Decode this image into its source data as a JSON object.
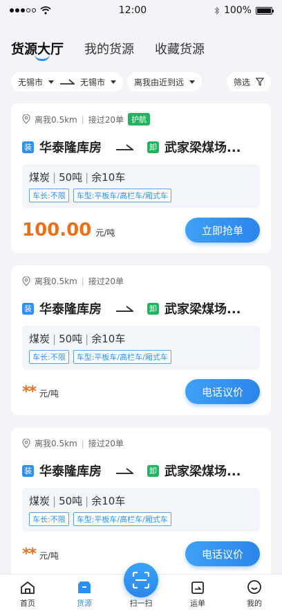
{
  "status": {
    "time": "12:00",
    "battery": "100%"
  },
  "tabs": [
    {
      "label": "货源大厅"
    },
    {
      "label": "我的货源"
    },
    {
      "label": "收藏货源"
    }
  ],
  "filters": {
    "from_city": "无锡市",
    "to_city": "无锡市",
    "sort": "离我由近到远",
    "filter_label": "筛选"
  },
  "cards": [
    {
      "distance": "离我0.5km",
      "accepted": "接过20单",
      "badge": "护航",
      "load_tag": "装",
      "from": "华泰隆库房",
      "unload_tag": "卸",
      "to": "武家梁煤场...",
      "goods": "煤炭",
      "weight": "50吨",
      "remain": "余10车",
      "req_length": "车长:不限",
      "req_type": "车型:平板车/高栏车/厢式车",
      "price": "100.00",
      "unit": "元/吨",
      "action": "立即抢单"
    },
    {
      "distance": "离我0.5km",
      "accepted": "接过20单",
      "load_tag": "装",
      "from": "华泰隆库房",
      "unload_tag": "卸",
      "to": "武家梁煤场...",
      "goods": "煤炭",
      "weight": "50吨",
      "remain": "余10车",
      "req_length": "车长:不限",
      "req_type": "车型:平板车/高栏车/厢式车",
      "price": "**",
      "unit": "元/吨",
      "action": "电话议价"
    },
    {
      "distance": "离我0.5km",
      "accepted": "接过20单",
      "load_tag": "装",
      "from": "华泰隆库房",
      "unload_tag": "卸",
      "to": "武家梁煤场...",
      "goods": "煤炭",
      "weight": "50吨",
      "remain": "余10车",
      "req_length": "车长:不限",
      "req_type": "车型:平板车/高栏车/厢式车",
      "price": "**",
      "unit": "元/吨",
      "action": "电话议价"
    }
  ],
  "nav": {
    "home": "首页",
    "cargo": "货源",
    "scan": "扫一扫",
    "waybill": "运单",
    "mine": "我的"
  },
  "colors": {
    "accent": "#2f8ff0",
    "price": "#e8711d",
    "green": "#22b35e"
  }
}
